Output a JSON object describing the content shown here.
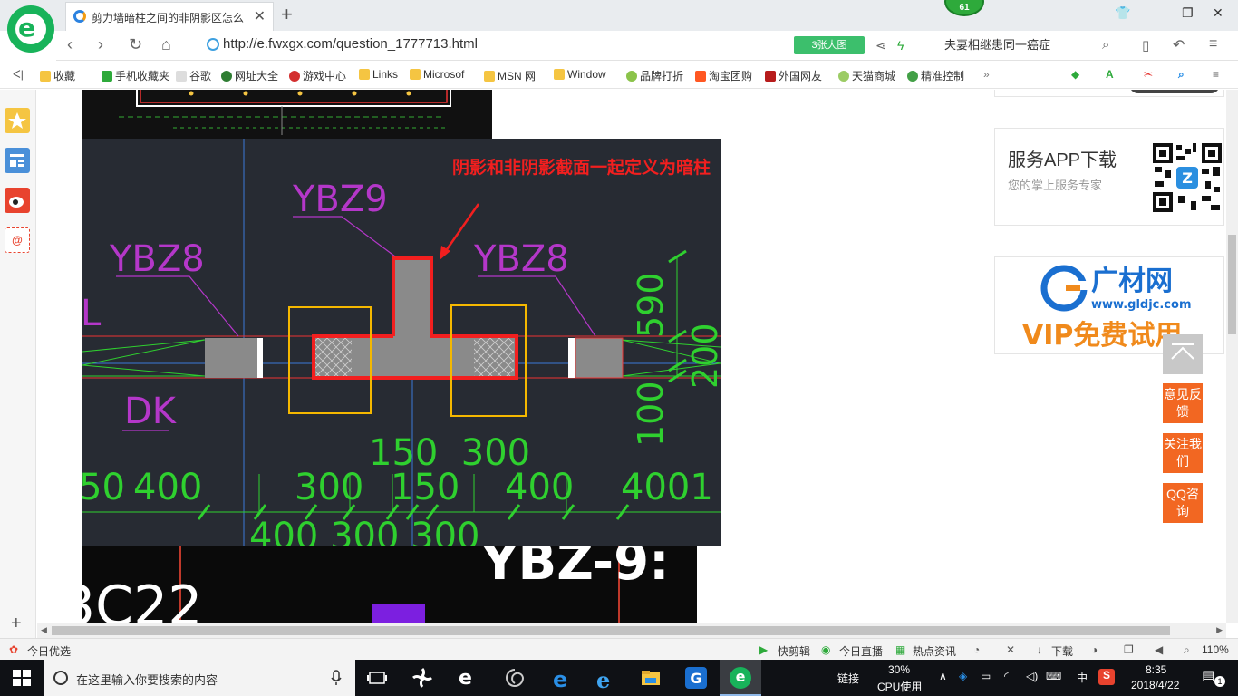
{
  "browser": {
    "tab_title": "剪力墙暗柱之间的非阴影区怎么",
    "extension_badge": "61",
    "url": "http://e.fwxgx.com/question_1777713.html",
    "bigimg_button": "3张大图",
    "search_text": "夫妻相继患同一癌症"
  },
  "bookmarks": [
    "收藏",
    "手机收藏夹",
    "谷歌",
    "网址大全",
    "游戏中心",
    "Links",
    "Microsof",
    "MSN 网",
    "Window",
    "品牌打折",
    "淘宝团购",
    "外国网友",
    "天猫商城",
    "精准控制"
  ],
  "cad": {
    "annotation": "阴影和非阴影截面一起定义为暗柱",
    "label_ybz9": "YBZ9",
    "label_ybz8_left": "YBZ8",
    "label_ybz8_right": "YBZ8",
    "label_l": "L",
    "label_dk": "DK",
    "dim_right_top": "590",
    "dim_right_mid": "200",
    "dim_right_bot": "100",
    "dim_row1": "150  300",
    "dim_row2": [
      "50",
      "400",
      "300",
      "150",
      "400",
      "4001"
    ],
    "dim_row3": "400 300 300",
    "bottom_text": "YBZ-9:",
    "bottom_left_text": "3C22"
  },
  "sidebar": {
    "service_title": "服务APP下载",
    "service_sub": "您的掌上服务专家",
    "ad_brand": "广材网",
    "ad_url": "www.gldjc.com",
    "ad_vip": "VIP免费试用",
    "feedback": "意见反馈",
    "follow": "关注我们",
    "qq": "QQ咨询"
  },
  "statusbar": {
    "today_pick": "今日优选",
    "quick_edit": "快剪辑",
    "live": "今日直播",
    "news": "热点资讯",
    "download": "下载",
    "zoom": "110%"
  },
  "taskbar": {
    "search_placeholder": "在这里输入你要搜索的内容",
    "link_label": "链接",
    "cpu_percent": "30%",
    "cpu_label": "CPU使用",
    "ime": "中",
    "time": "8:35",
    "date": "2018/4/22",
    "notif_count": "1"
  }
}
